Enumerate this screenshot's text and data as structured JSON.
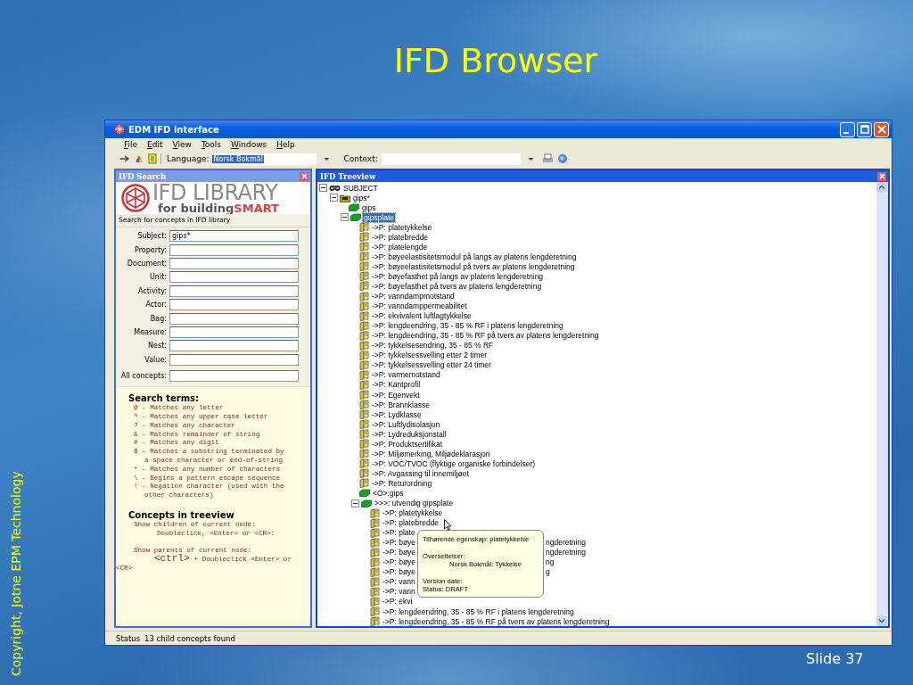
{
  "slide": {
    "title": "IFD Browser",
    "copyright": "Copyright, Jotne EPM Technology",
    "slide_number": "Slide 37"
  },
  "window": {
    "title": "EDM IFD interface"
  },
  "menu": [
    "File",
    "Edit",
    "View",
    "Tools",
    "Windows",
    "Help"
  ],
  "toolbar": {
    "language_label": "Language:",
    "language_value": "Norsk Bokmål",
    "context_label": "Context:"
  },
  "search_panel": {
    "title": "IFD Search",
    "logo": {
      "name": "IFD LIBRARY",
      "tagline": "for building",
      "tagline_accent": "SMART"
    },
    "caption": "Search for concepts in IFD library",
    "fields": [
      {
        "label": "Subject:",
        "value": "gips*"
      },
      {
        "label": "Property:"
      },
      {
        "label": "Document:"
      },
      {
        "label": "Unit:"
      },
      {
        "label": "Activity:"
      },
      {
        "label": "Actor:"
      },
      {
        "label": "Bag:"
      },
      {
        "label": "Measure:"
      },
      {
        "label": "Nest:"
      },
      {
        "label": "Value:"
      },
      {
        "label": "All concepts:"
      }
    ],
    "terms_heading": "Search terms:",
    "terms": [
      {
        "line": "@ - Matches any letter"
      },
      {
        "line": "^ - Matches any upper case letter"
      },
      {
        "line": "? - Matches any character"
      },
      {
        "line": "& - Matches remainder of string"
      },
      {
        "line": "# - Matches any digit"
      },
      {
        "line": "$ - Matches a substring terminated by",
        "more": "a space character or end-of-string"
      },
      {
        "line": "* - Matches any number of characters"
      },
      {
        "line": "\\ - Begins a pattern escape sequence"
      },
      {
        "line": "! - Negation character (used with the",
        "more": "other characters)"
      }
    ],
    "tree_heading": "Concepts in treeview",
    "tree_help": [
      {
        "title": "Show children of current node:",
        "action": "Doubleclick, <Enter> or <CR>:"
      },
      {
        "title": "Show parents of current node:",
        "key": "<ctrl>",
        "action": "+ Doubleclick <Enter> or",
        "overflow": "<CR>"
      }
    ]
  },
  "tree_panel": {
    "title": "IFD Treeview",
    "tree": [
      {
        "kind": "subject",
        "text": "SUBJECT",
        "selected": false,
        "expanded": true,
        "children": [
          {
            "kind": "folder",
            "text": "gips*",
            "selected": false,
            "expanded": true,
            "children": [
              {
                "kind": "object",
                "text": "gips",
                "selected": false
              },
              {
                "kind": "object",
                "text": "gipsplate",
                "selected": true,
                "expanded": true,
                "children": [
                  {
                    "kind": "property",
                    "text": "->P: platetykkelse",
                    "selected": false
                  },
                  {
                    "kind": "property",
                    "text": "->P: platebredde",
                    "selected": false
                  },
                  {
                    "kind": "property",
                    "text": "->P: platelengde",
                    "selected": false
                  },
                  {
                    "kind": "property",
                    "text": "->P: bøyeelastisitetsmodul på langs av platens lengderetning",
                    "selected": false
                  },
                  {
                    "kind": "property",
                    "text": "->P: bøyeelastisitetsmodul på tvers av platens lengderetning",
                    "selected": false
                  },
                  {
                    "kind": "property",
                    "text": "->P: bøyefasthet på langs av platens lengderetning",
                    "selected": false
                  },
                  {
                    "kind": "property",
                    "text": "->P: bøyefasthet på tvers av platens lengderetning",
                    "selected": false
                  },
                  {
                    "kind": "property",
                    "text": "->P: vanndampmotstand",
                    "selected": false
                  },
                  {
                    "kind": "property",
                    "text": "->P: vanndamppermeabilitet",
                    "selected": false
                  },
                  {
                    "kind": "property",
                    "text": "->P: ekvivalent luftlagtykkelse",
                    "selected": false
                  },
                  {
                    "kind": "property",
                    "text": "->P: lengdeendring, 35 - 85 % RF i platens lengderetning",
                    "selected": false
                  },
                  {
                    "kind": "property",
                    "text": "->P: lengdeendring, 35 - 85 % RF på tvers av platens lengderetning",
                    "selected": false
                  },
                  {
                    "kind": "property",
                    "text": "->P: tykkelsesendring, 35 - 85 % RF",
                    "selected": false
                  },
                  {
                    "kind": "property",
                    "text": "->P: tykkelsessvelling etter 2 timer",
                    "selected": false
                  },
                  {
                    "kind": "property",
                    "text": "->P: tykkelsessvelling etter 24 timer",
                    "selected": false
                  },
                  {
                    "kind": "property",
                    "text": "->P: varmemotstand",
                    "selected": false
                  },
                  {
                    "kind": "property",
                    "text": "->P: Kantprofil",
                    "selected": false
                  },
                  {
                    "kind": "property",
                    "text": "->P: Egenvekt",
                    "selected": false
                  },
                  {
                    "kind": "property",
                    "text": "->P: Brannklasse",
                    "selected": false
                  },
                  {
                    "kind": "property",
                    "text": "->P: Lydklasse",
                    "selected": false
                  },
                  {
                    "kind": "property",
                    "text": "->P: Luftlydisolasjon",
                    "selected": false
                  },
                  {
                    "kind": "property",
                    "text": "->P: Lydreduksjonstall",
                    "selected": false
                  },
                  {
                    "kind": "property",
                    "text": "->P: Produktsertifikat",
                    "selected": false
                  },
                  {
                    "kind": "property",
                    "text": "->P: Miljømerking, Miljødeklarasjon",
                    "selected": false
                  },
                  {
                    "kind": "property",
                    "text": "->P: VOC/TVOC (flyktige organiske forbindelser)",
                    "selected": false
                  },
                  {
                    "kind": "property",
                    "text": "->P: Avgassing til innemiljøet",
                    "selected": false
                  },
                  {
                    "kind": "property",
                    "text": "->P: Returordning",
                    "selected": false
                  },
                  {
                    "kind": "object",
                    "text": "<O>:gips",
                    "selected": false
                  },
                  {
                    "kind": "object",
                    "text": ">>>: utvendig gipsplate",
                    "selected": false,
                    "expanded": true,
                    "children": [
                      {
                        "kind": "property",
                        "text": "->P: platetykkelse",
                        "selected": false
                      },
                      {
                        "kind": "property",
                        "text": "->P: platebredde",
                        "selected": false
                      },
                      {
                        "kind": "property",
                        "text": "->P: plate",
                        "selected": false
                      },
                      {
                        "kind": "property",
                        "text": "->P: bøye",
                        "tail": "ngderetning",
                        "selected": false
                      },
                      {
                        "kind": "property",
                        "text": "->P: bøye",
                        "tail": "ngderetning",
                        "selected": false
                      },
                      {
                        "kind": "property",
                        "text": "->P: bøye",
                        "tail": "ng",
                        "selected": false
                      },
                      {
                        "kind": "property",
                        "text": "->P: bøye",
                        "tail": "g",
                        "selected": false
                      },
                      {
                        "kind": "property",
                        "text": "->P: vann",
                        "selected": false
                      },
                      {
                        "kind": "property",
                        "text": "->P: vann",
                        "selected": false
                      },
                      {
                        "kind": "property",
                        "text": "->P: ekvi",
                        "selected": false
                      },
                      {
                        "kind": "property",
                        "text": "->P: lengdeendring, 35 - 85 % RF i platens lengderetning",
                        "selected": false
                      },
                      {
                        "kind": "property",
                        "text": "->P: lengdeendring, 35 - 85 % RF på tvers av platens lengderetning",
                        "selected": false
                      }
                    ]
                  }
                ]
              }
            ]
          }
        ]
      }
    ],
    "tooltip": {
      "heading": "Tilhørende egenskap: platetykkelse",
      "translations_label": "Oversettelser:",
      "translation": "Norsk Bokmål: Tykkelse",
      "version_date": "Version date:",
      "status": "Status: DRAFT"
    }
  },
  "status_bar": {
    "label": "Status",
    "message": "13 child concepts found"
  }
}
